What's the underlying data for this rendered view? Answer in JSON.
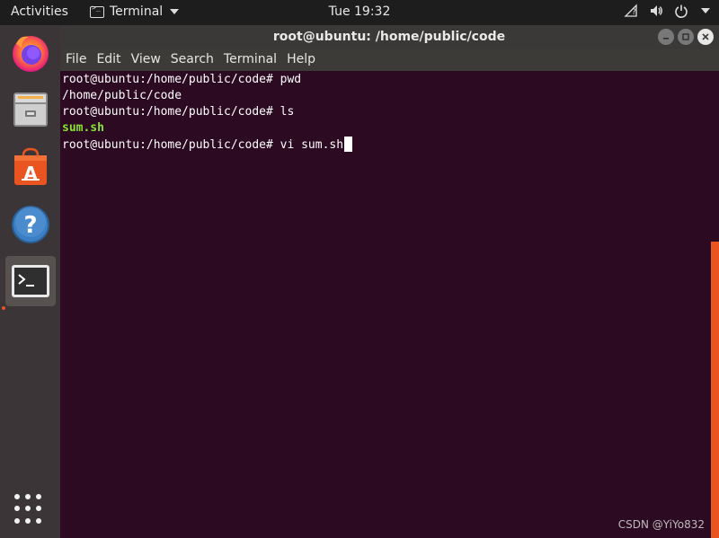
{
  "topbar": {
    "activities": "Activities",
    "app_name": "Terminal",
    "clock": "Tue 19:32"
  },
  "dock": {
    "items": [
      {
        "name": "Firefox",
        "icon": "firefox-icon"
      },
      {
        "name": "Files",
        "icon": "files-icon"
      },
      {
        "name": "Ubuntu Software",
        "icon": "software-icon"
      },
      {
        "name": "Help",
        "icon": "help-icon"
      },
      {
        "name": "Terminal",
        "icon": "terminal-icon",
        "active": true
      }
    ]
  },
  "window": {
    "title": "root@ubuntu: /home/public/code"
  },
  "menu": {
    "items": [
      "File",
      "Edit",
      "View",
      "Search",
      "Terminal",
      "Help"
    ]
  },
  "terminal": {
    "lines": [
      "root@ubuntu:/home/public/code# pwd",
      "/home/public/code",
      "root@ubuntu:/home/public/code# ls",
      "sum.sh",
      "root@ubuntu:/home/public/code# vi sum.sh"
    ]
  },
  "watermark": "CSDN @YiYo832",
  "colors": {
    "terminal_bg": "#2c0a21",
    "accent": "#e95420",
    "ls_file": "#8ae234"
  }
}
